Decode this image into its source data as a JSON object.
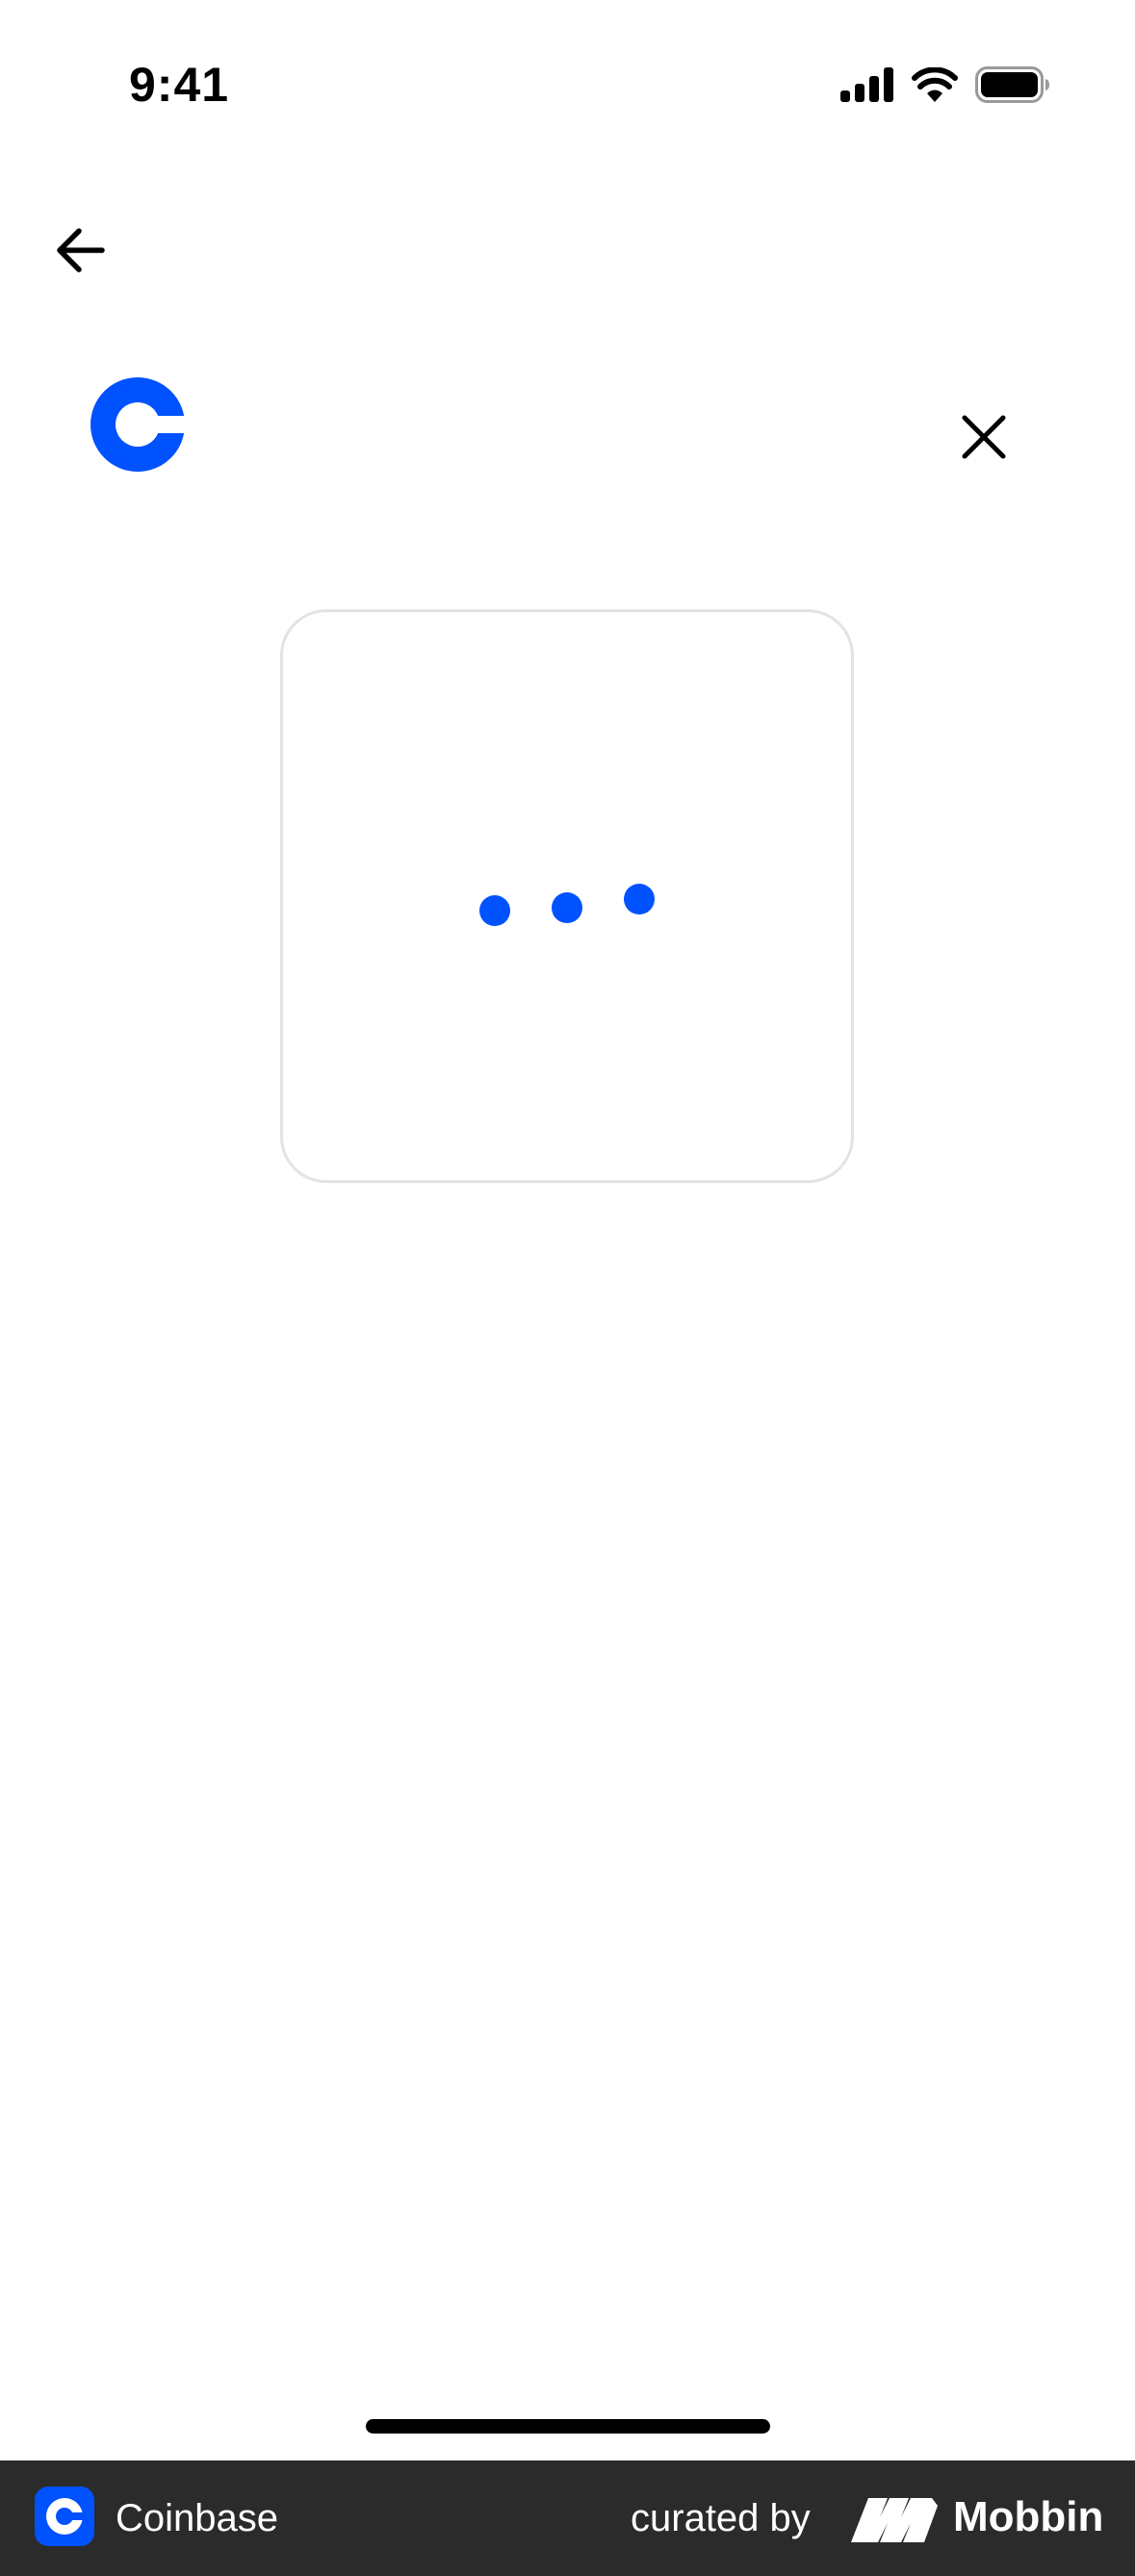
{
  "status_bar": {
    "time": "9:41",
    "icons": [
      "cellular-signal-icon",
      "wifi-icon",
      "battery-icon"
    ]
  },
  "navigation": {
    "back_icon": "arrow-left-icon",
    "close_icon": "close-icon"
  },
  "brand": {
    "logo_icon": "coinbase-logo-icon"
  },
  "loading": {
    "indicator": "three-dot-loading-indicator",
    "dots": 3
  },
  "attribution": {
    "app_name": "Coinbase",
    "curated_label": "curated by",
    "curator_name": "Mobbin"
  },
  "colors": {
    "accent": "#0052ff",
    "text": "#000000",
    "card_border": "#e3e3e3",
    "attribution_bg": "#2b2b2b",
    "attribution_text": "#ffffff"
  }
}
